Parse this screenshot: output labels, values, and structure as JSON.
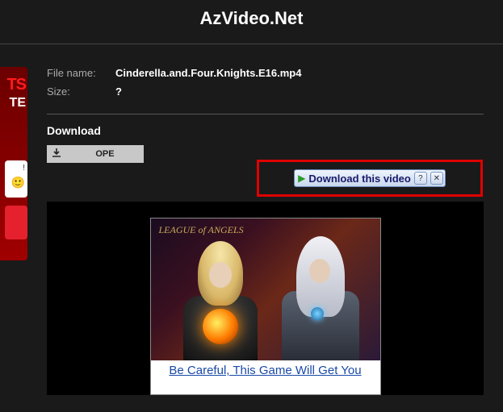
{
  "header": {
    "title": "AzVideo.Net"
  },
  "meta": {
    "filename_label": "File name:",
    "filename_value": "Cinderella.and.Four.Knights.E16.mp4",
    "size_label": "Size:",
    "size_value": "?"
  },
  "download": {
    "heading": "Download",
    "ope_button": "OPE",
    "download_icon": "download-icon"
  },
  "ie_toolbar": {
    "label": "Download this video",
    "help": "?",
    "close": "✕"
  },
  "left_ad": {
    "red": "TS",
    "white": "TE",
    "small": "!",
    "emoji": "🙂"
  },
  "game_ad": {
    "logo": "LEAGUE of ANGELS",
    "caption": "Be Careful, This Game Will Get You"
  }
}
